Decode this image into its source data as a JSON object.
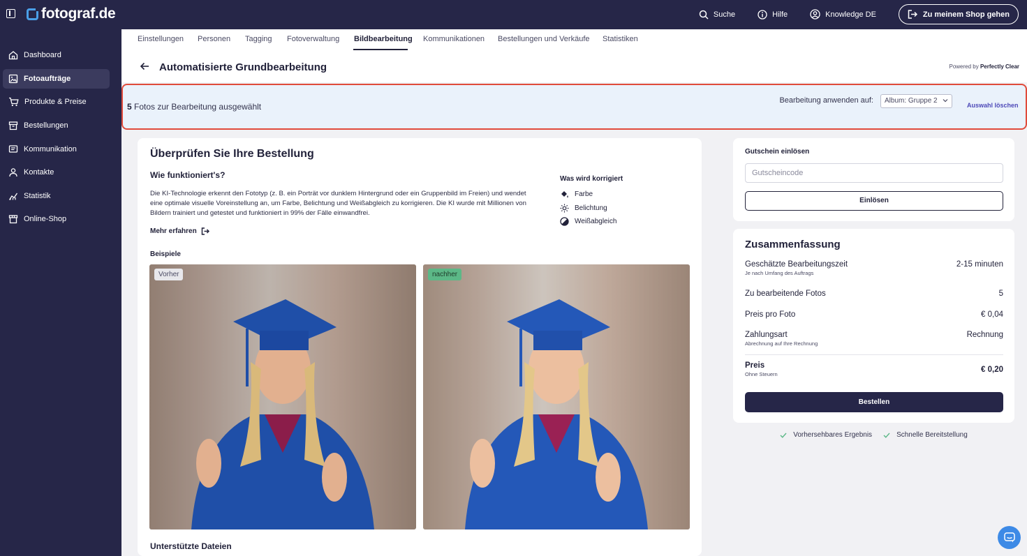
{
  "brand": {
    "name": "fotograf.de"
  },
  "topnav": {
    "search": "Suche",
    "help": "Hilfe",
    "knowledge": "Knowledge DE",
    "shop_button": "Zu meinem Shop gehen"
  },
  "sidebar": {
    "items": [
      {
        "label": "Dashboard"
      },
      {
        "label": "Fotoaufträge"
      },
      {
        "label": "Produkte & Preise"
      },
      {
        "label": "Bestellungen"
      },
      {
        "label": "Kommunikation"
      },
      {
        "label": "Kontakte"
      },
      {
        "label": "Statistik"
      },
      {
        "label": "Online-Shop"
      }
    ]
  },
  "tabs": [
    {
      "label": "Einstellungen"
    },
    {
      "label": "Personen"
    },
    {
      "label": "Tagging"
    },
    {
      "label": "Fotoverwaltung"
    },
    {
      "label": "Bildbearbeitung"
    },
    {
      "label": "Kommunikationen"
    },
    {
      "label": "Bestellungen und Verkäufe"
    },
    {
      "label": "Statistiken"
    }
  ],
  "page": {
    "title": "Automatisierte Grundbearbeitung",
    "powered_prefix": "Powered by",
    "powered_brand": "Perfectly Clear"
  },
  "selection": {
    "count": "5",
    "count_text": "Fotos zur Bearbeitung ausgewählt",
    "apply_label": "Bearbeitung anwenden auf:",
    "album_value": "Album: Gruppe 2",
    "clear_link": "Auswahl löschen"
  },
  "review": {
    "title": "Überprüfen Sie Ihre Bestellung",
    "how_title": "Wie funktioniert's?",
    "how_text": "Die KI-Technologie erkennt den Fototyp (z. B. ein Porträt vor dunklem Hintergrund oder ein Gruppenbild im Freien) und wendet eine optimale visuelle Voreinstellung an, um Farbe, Belichtung und Weißabgleich zu korrigieren. Die KI wurde mit Millionen von Bildern trainiert und getestet und funktioniert in 99% der Fälle einwandfrei.",
    "more_link": "Mehr erfahren",
    "corrections_title": "Was wird korrigiert",
    "corrections": [
      {
        "label": "Farbe",
        "icon": "paint-bucket-icon"
      },
      {
        "label": "Belichtung",
        "icon": "sun-icon"
      },
      {
        "label": "Weißabgleich",
        "icon": "contrast-icon"
      }
    ],
    "examples_title": "Beispiele",
    "before_label": "Vorher",
    "after_label": "nachher",
    "supported_title": "Unterstützte Dateien"
  },
  "coupon": {
    "title": "Gutschein einlösen",
    "placeholder": "Gutscheincode",
    "button": "Einlösen"
  },
  "summary": {
    "title": "Zusammenfassung",
    "rows": [
      {
        "label": "Geschätzte Bearbeitungszeit",
        "sub": "Je nach Umfang des Auftrags",
        "value": "2-15 minuten"
      },
      {
        "label": "Zu bearbeitende Fotos",
        "sub": "",
        "value": "5"
      },
      {
        "label": "Preis pro Foto",
        "sub": "",
        "value": "€ 0,04"
      },
      {
        "label": "Zahlungsart",
        "sub": "Abrechnung auf Ihre Rechnung",
        "value": "Rechnung"
      }
    ],
    "total": {
      "label": "Preis",
      "sub": "Ohne Steuern",
      "value": "€ 0,20"
    },
    "order_button": "Bestellen"
  },
  "benefits": [
    {
      "label": "Vorhersehbares Ergebnis"
    },
    {
      "label": "Schnelle Bereitstellung"
    }
  ],
  "colors": {
    "sidebar_bg": "#262648",
    "accent_link": "#4d49b8",
    "highlight_border": "#e04b3b",
    "selection_bg": "#eaf2fb",
    "after_badge": "#5cb887",
    "chat_button": "#3d8ae6"
  }
}
